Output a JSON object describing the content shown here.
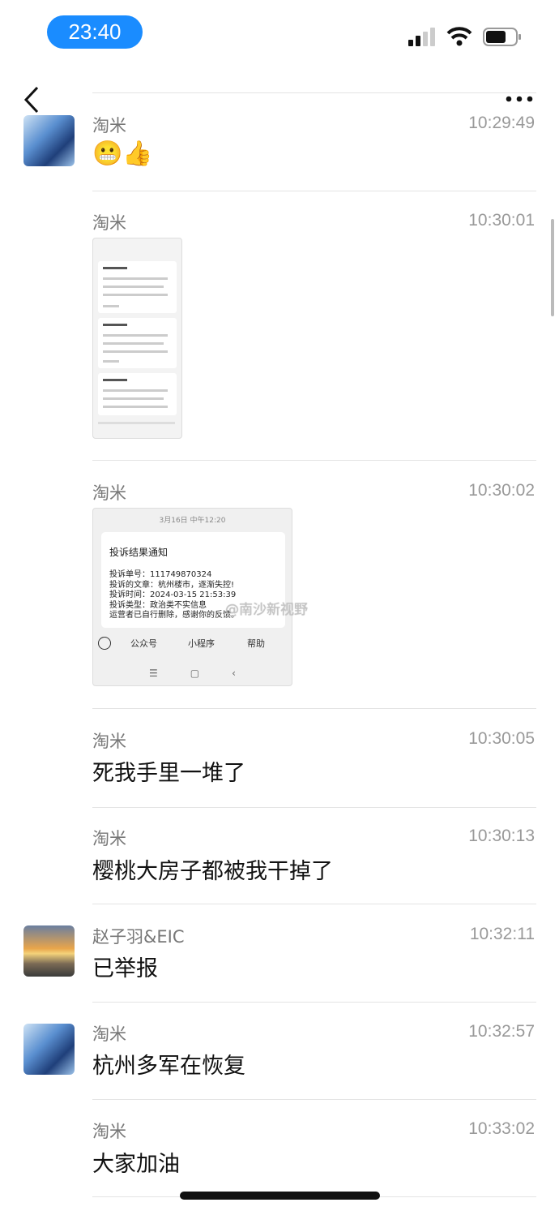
{
  "status_bar": {
    "time": "23:40",
    "signal-icon": "signal",
    "wifi-icon": "wifi",
    "battery-icon": "battery"
  },
  "nav": {
    "back": "back-icon",
    "more": "more-icon"
  },
  "messages": [
    {
      "name": "淘米",
      "time": "10:29:49",
      "content": "😬👍"
    },
    {
      "name": "淘米",
      "time": "10:30:01",
      "image": "system-notification-screenshot"
    },
    {
      "name": "淘米",
      "time": "10:30:02",
      "image": {
        "date": "3月16日 中午12:20",
        "title": "投诉结果通知",
        "lines": [
          "投诉单号：111749870324",
          "投诉的文章：杭州楼市，逐渐失控!",
          "投诉时间：2024-03-15 21:53:39",
          "投诉类型：政治类不实信息",
          "运营者已自行删除，感谢你的反馈。"
        ],
        "menu": [
          "公众号",
          "小程序",
          "帮助"
        ],
        "watermark": "@南沙新视野"
      }
    },
    {
      "name": "淘米",
      "time": "10:30:05",
      "content": "死我手里一堆了"
    },
    {
      "name": "淘米",
      "time": "10:30:13",
      "content": "樱桃大房子都被我干掉了"
    },
    {
      "name": "赵子羽&EIC",
      "time": "10:32:11",
      "content": "已举报"
    },
    {
      "name": "淘米",
      "time": "10:32:57",
      "content": "杭州多军在恢复"
    },
    {
      "name": "淘米",
      "time": "10:33:02",
      "content": "大家加油"
    }
  ]
}
